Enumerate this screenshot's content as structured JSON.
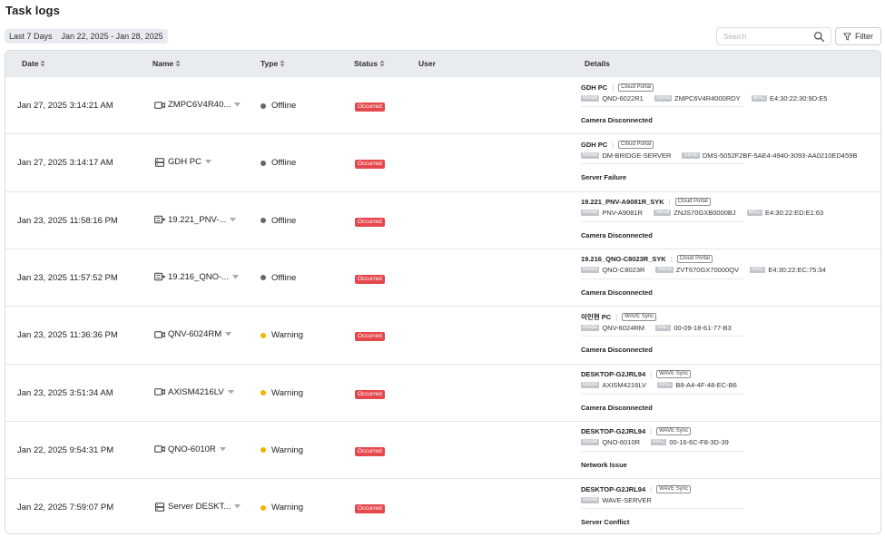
{
  "page": {
    "title": "Task  logs"
  },
  "date_filter": {
    "range_label": "Last 7 Days",
    "range_value": "Jan 22, 2025 - Jan 28, 2025"
  },
  "search": {
    "placeholder": "Search",
    "value": ""
  },
  "filter_button": {
    "label": "Filter"
  },
  "columns": {
    "date": "Date",
    "name": "Name",
    "type": "Type",
    "status": "Status",
    "user": "User",
    "details": "Details"
  },
  "rows": [
    {
      "date": "Jan 27, 2025 3:14:21 AM",
      "name": "ZMPC6V4R40...",
      "device": "camera",
      "type": "Offline",
      "type_color": "#666666",
      "status": "Occurred",
      "user": "",
      "details": {
        "title": "GDH PC",
        "source": "Cloud Portal",
        "props": [
          {
            "tag": "Model",
            "value": "QND-6022R1"
          },
          {
            "tag": "Serial",
            "value": "ZMPC6V4R4000RDY"
          },
          {
            "tag": "MAC",
            "value": "E4:30:22:30:9D:E5"
          }
        ],
        "summary": "Camera Disconnected"
      }
    },
    {
      "date": "Jan 27, 2025 3:14:17 AM",
      "name": "GDH PC",
      "device": "server",
      "type": "Offline",
      "type_color": "#666666",
      "status": "Occurred",
      "user": "",
      "details": {
        "title": "GDH PC",
        "source": "Cloud Portal",
        "props": [
          {
            "tag": "Model",
            "value": "DM-BRIDGE-SERVER"
          },
          {
            "tag": "Serial",
            "value": "DMS-5052F2BF-5AE4-4940-3093-AA0210ED459B"
          }
        ],
        "summary": "Server Failure"
      }
    },
    {
      "date": "Jan 23, 2025 11:58:16 PM",
      "name": "19.221_PNV-...",
      "device": "encoder",
      "type": "Offline",
      "type_color": "#666666",
      "status": "Occurred",
      "user": "",
      "details": {
        "title": "19.221_PNV-A9081R_SYK",
        "source": "Cloud Portal",
        "props": [
          {
            "tag": "Model",
            "value": "PNV-A9081R"
          },
          {
            "tag": "Serial",
            "value": "ZNJS70GXB0000BJ"
          },
          {
            "tag": "MAC",
            "value": "E4:30:22:ED:E1:63"
          }
        ],
        "summary": "Camera Disconnected"
      }
    },
    {
      "date": "Jan 23, 2025 11:57:52 PM",
      "name": "19.216_QNO-...",
      "device": "encoder",
      "type": "Offline",
      "type_color": "#666666",
      "status": "Occurred",
      "user": "",
      "details": {
        "title": "19.216_QNO-C8023R_SYK",
        "source": "Cloud Portal",
        "props": [
          {
            "tag": "Model",
            "value": "QNO-C8023R"
          },
          {
            "tag": "Serial",
            "value": "ZVT670GX70000QV"
          },
          {
            "tag": "MAC",
            "value": "E4:30:22:EC:75:34"
          }
        ],
        "summary": "Camera Disconnected"
      }
    },
    {
      "date": "Jan 23, 2025 11:36:36 PM",
      "name": "QNV-6024RM",
      "device": "camera",
      "type": "Warning",
      "type_color": "#f5b400",
      "status": "Occurred",
      "user": "",
      "details": {
        "title": "이인현 PC",
        "source": "WAVE Sync",
        "props": [
          {
            "tag": "Model",
            "value": "QNV-6024RM"
          },
          {
            "tag": "MAC",
            "value": "00-09-18-61-77-B3"
          }
        ],
        "summary": "Camera Disconnected"
      }
    },
    {
      "date": "Jan 23, 2025 3:51:34 AM",
      "name": "AXISM4216LV",
      "device": "camera",
      "type": "Warning",
      "type_color": "#f5b400",
      "status": "Occurred",
      "user": "",
      "details": {
        "title": "DESKTOP-G2JRL94",
        "source": "WAVE Sync",
        "props": [
          {
            "tag": "Model",
            "value": "AXISM4216LV"
          },
          {
            "tag": "MAC",
            "value": "B8-A4-4F-48-EC-B6"
          }
        ],
        "summary": "Camera Disconnected"
      }
    },
    {
      "date": "Jan 22, 2025 9:54:31 PM",
      "name": "QNO-6010R",
      "device": "camera",
      "type": "Warning",
      "type_color": "#f5b400",
      "status": "Occurred",
      "user": "",
      "details": {
        "title": "DESKTOP-G2JRL94",
        "source": "WAVE Sync",
        "props": [
          {
            "tag": "Model",
            "value": "QNO-6010R"
          },
          {
            "tag": "MAC",
            "value": "00-16-6C-F8-3D-39"
          }
        ],
        "summary": "Network Issue"
      }
    },
    {
      "date": "Jan 22, 2025 7:59:07 PM",
      "name": "Server DESKT...",
      "device": "server",
      "type": "Warning",
      "type_color": "#f5b400",
      "status": "Occurred",
      "user": "",
      "details": {
        "title": "DESKTOP-G2JRL94",
        "source": "WAVE Sync",
        "props": [
          {
            "tag": "Model",
            "value": "WAVE-SERVER"
          }
        ],
        "summary": "Server Conflict"
      }
    }
  ]
}
